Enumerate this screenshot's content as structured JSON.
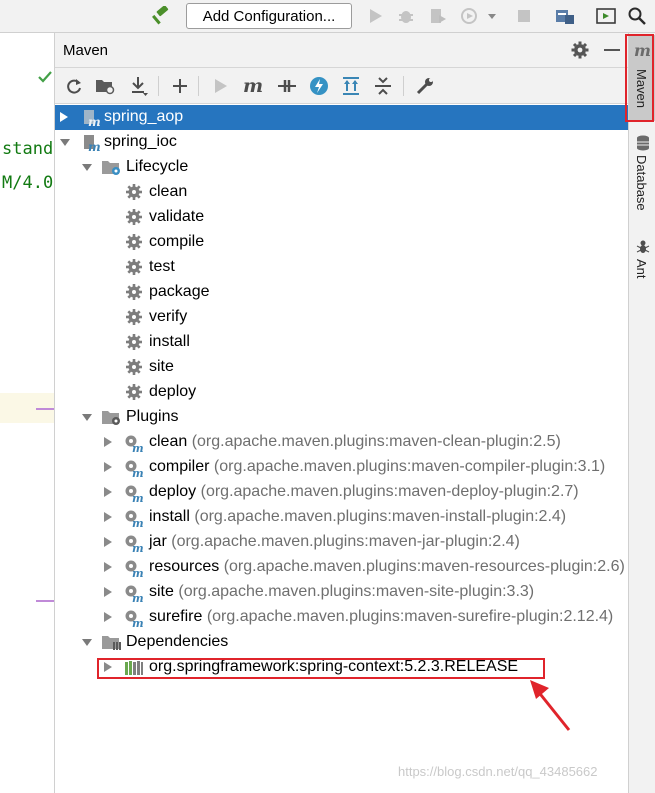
{
  "toolbar": {
    "add_configuration_label": "Add Configuration..."
  },
  "editor": {
    "code_lines": [
      "standa",
      "M/4.0"
    ]
  },
  "maven_panel": {
    "title": "Maven"
  },
  "tree": {
    "project_aop": "spring_aop",
    "project_ioc": "spring_ioc",
    "lifecycle_label": "Lifecycle",
    "lifecycle_goals": [
      "clean",
      "validate",
      "compile",
      "test",
      "package",
      "verify",
      "install",
      "site",
      "deploy"
    ],
    "plugins_label": "Plugins",
    "plugins": [
      {
        "name": "clean",
        "coord": "(org.apache.maven.plugins:maven-clean-plugin:2.5)"
      },
      {
        "name": "compiler",
        "coord": "(org.apache.maven.plugins:maven-compiler-plugin:3.1)"
      },
      {
        "name": "deploy",
        "coord": "(org.apache.maven.plugins:maven-deploy-plugin:2.7)"
      },
      {
        "name": "install",
        "coord": "(org.apache.maven.plugins:maven-install-plugin:2.4)"
      },
      {
        "name": "jar",
        "coord": "(org.apache.maven.plugins:maven-jar-plugin:2.4)"
      },
      {
        "name": "resources",
        "coord": "(org.apache.maven.plugins:maven-resources-plugin:2.6)"
      },
      {
        "name": "site",
        "coord": "(org.apache.maven.plugins:maven-site-plugin:3.3)"
      },
      {
        "name": "surefire",
        "coord": "(org.apache.maven.plugins:maven-surefire-plugin:2.12.4)"
      }
    ],
    "dependencies_label": "Dependencies",
    "dependency": "org.springframework:spring-context:5.2.3.RELEASE"
  },
  "side_tabs": {
    "maven": "Maven",
    "database": "Database",
    "ant": "Ant"
  },
  "watermark": "https://blog.csdn.net/qq_43485662",
  "colors": {
    "selection": "#2675bf",
    "annotation_red": "#e0242b",
    "panel_bg": "#f2f2f2"
  }
}
